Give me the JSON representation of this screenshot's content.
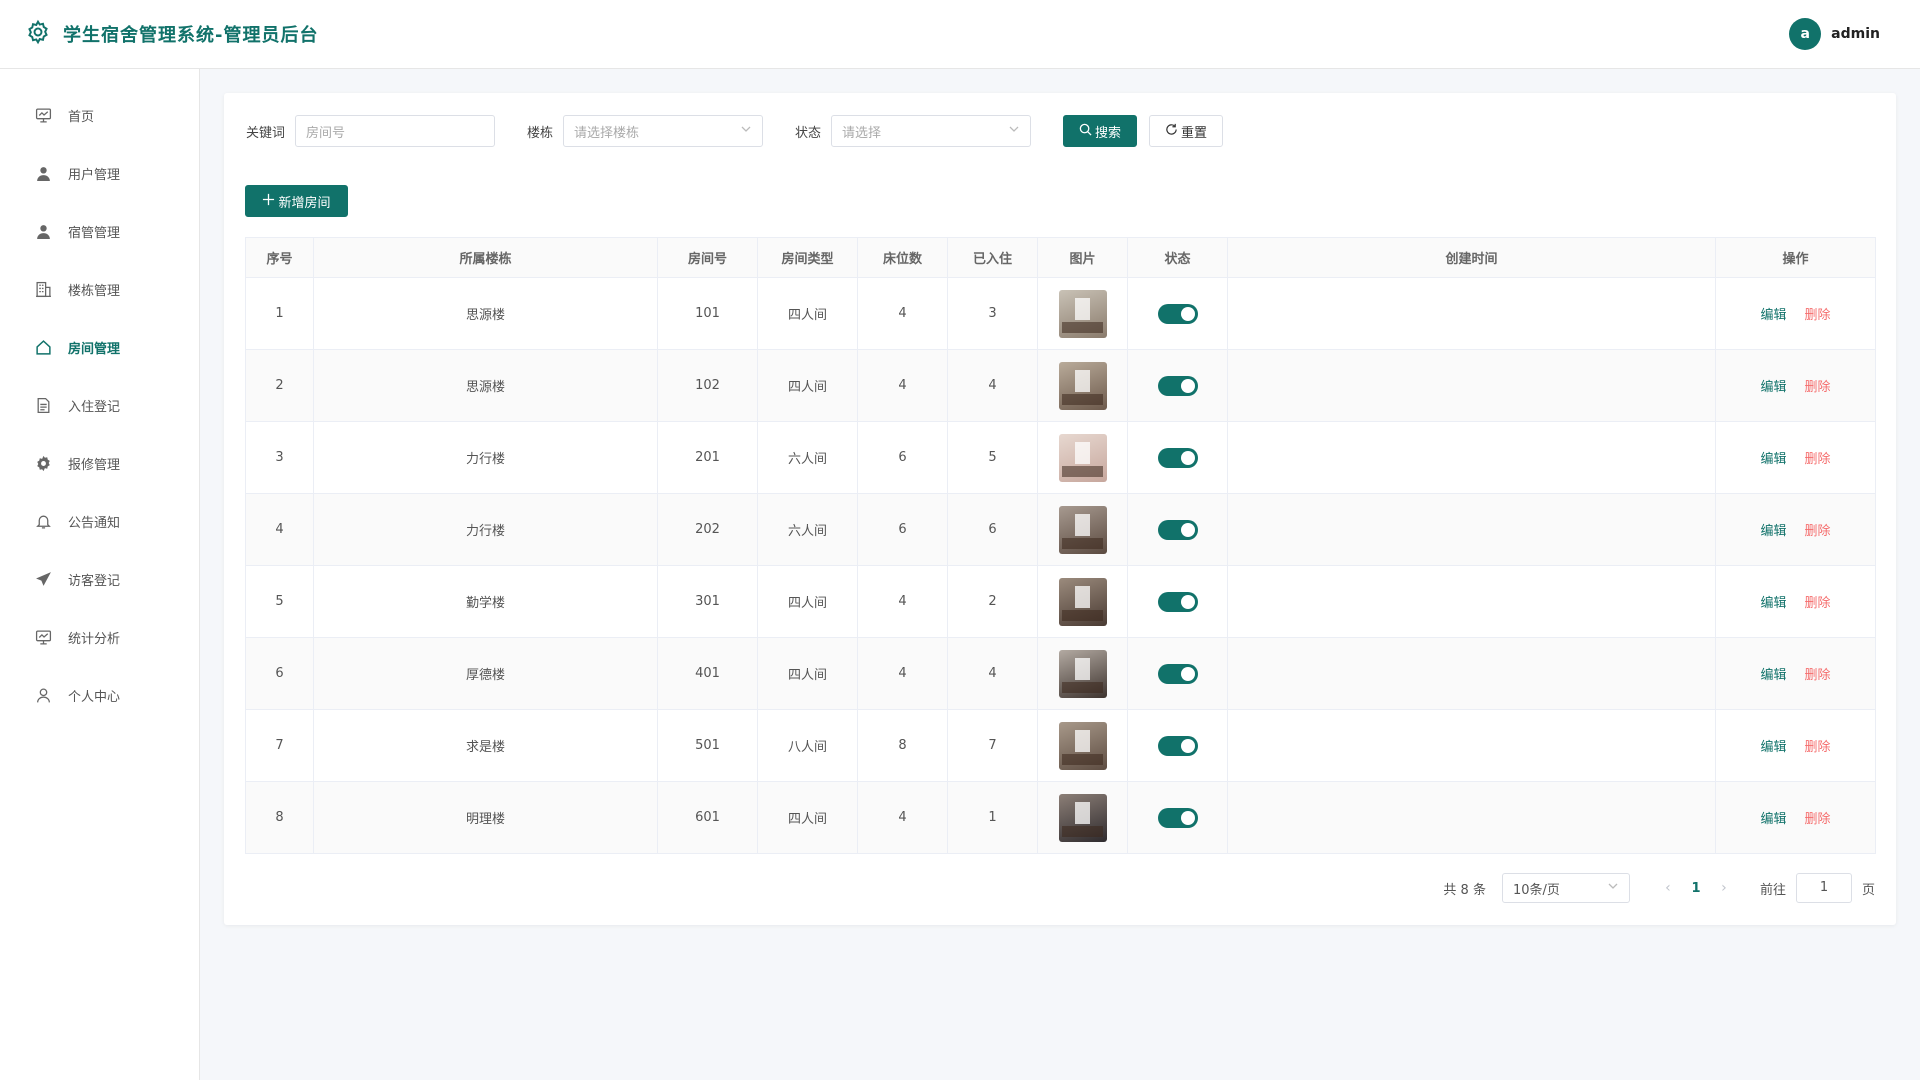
{
  "header": {
    "title": "学生宿舍管理系统-管理员后台",
    "avatar_letter": "a",
    "username": "admin"
  },
  "sidebar": {
    "items": [
      {
        "label": "首页",
        "icon": "dashboard-icon"
      },
      {
        "label": "用户管理",
        "icon": "user-icon"
      },
      {
        "label": "宿管管理",
        "icon": "user-icon"
      },
      {
        "label": "楼栋管理",
        "icon": "building-icon"
      },
      {
        "label": "房间管理",
        "icon": "home-icon",
        "active": true
      },
      {
        "label": "入住登记",
        "icon": "document-icon"
      },
      {
        "label": "报修管理",
        "icon": "gear-icon"
      },
      {
        "label": "公告通知",
        "icon": "bell-icon"
      },
      {
        "label": "访客登记",
        "icon": "send-icon"
      },
      {
        "label": "统计分析",
        "icon": "chart-icon"
      },
      {
        "label": "个人中心",
        "icon": "person-outline-icon"
      }
    ]
  },
  "filters": {
    "keyword_label": "关键词",
    "keyword_placeholder": "房间号",
    "building_label": "楼栋",
    "building_placeholder": "请选择楼栋",
    "status_label": "状态",
    "status_placeholder": "请选择",
    "search_label": "搜索",
    "reset_label": "重置"
  },
  "add_button_label": "新增房间",
  "table": {
    "headers": [
      "序号",
      "所属楼栋",
      "房间号",
      "房间类型",
      "床位数",
      "已入住",
      "图片",
      "状态",
      "创建时间",
      "操作"
    ],
    "edit_label": "编辑",
    "delete_label": "删除",
    "rows": [
      {
        "index": "1",
        "building": "思源楼",
        "room": "101",
        "type": "四人间",
        "beds": "4",
        "occupied": "3",
        "created": "",
        "status_on": true,
        "thumb": [
          "#8a7b6c",
          "#c9c2b6"
        ]
      },
      {
        "index": "2",
        "building": "思源楼",
        "room": "102",
        "type": "四人间",
        "beds": "4",
        "occupied": "4",
        "created": "",
        "status_on": true,
        "thumb": [
          "#6d5a4c",
          "#b9ab9a"
        ]
      },
      {
        "index": "3",
        "building": "力行楼",
        "room": "201",
        "type": "六人间",
        "beds": "6",
        "occupied": "5",
        "created": "",
        "status_on": true,
        "thumb": [
          "#c7a79d",
          "#e7d8d0"
        ]
      },
      {
        "index": "4",
        "building": "力行楼",
        "room": "202",
        "type": "六人间",
        "beds": "6",
        "occupied": "6",
        "created": "",
        "status_on": true,
        "thumb": [
          "#5b4a40",
          "#a79a90"
        ]
      },
      {
        "index": "5",
        "building": "勤学楼",
        "room": "301",
        "type": "四人间",
        "beds": "4",
        "occupied": "2",
        "created": "",
        "status_on": true,
        "thumb": [
          "#4a3b33",
          "#9b8b7d"
        ]
      },
      {
        "index": "6",
        "building": "厚德楼",
        "room": "401",
        "type": "四人间",
        "beds": "4",
        "occupied": "4",
        "created": "",
        "status_on": true,
        "thumb": [
          "#3e342f",
          "#b3aaa2"
        ]
      },
      {
        "index": "7",
        "building": "求是楼",
        "room": "501",
        "type": "八人间",
        "beds": "8",
        "occupied": "7",
        "created": "",
        "status_on": true,
        "thumb": [
          "#5e4d42",
          "#a8998a"
        ]
      },
      {
        "index": "8",
        "building": "明理楼",
        "room": "601",
        "type": "四人间",
        "beds": "4",
        "occupied": "1",
        "created": "",
        "status_on": true,
        "thumb": [
          "#2f2b2e",
          "#8c7f77"
        ]
      }
    ]
  },
  "pagination": {
    "total": "共 8 条",
    "page_size": "10条/页",
    "current_page": "1",
    "goto_label": "前往",
    "goto_value": "1",
    "page_suffix": "页"
  },
  "colors": {
    "accent": "#11726a",
    "danger": "#f56c6c"
  }
}
